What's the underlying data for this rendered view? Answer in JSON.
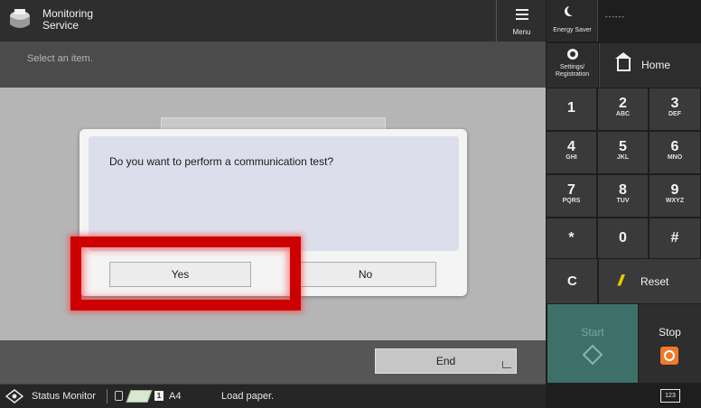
{
  "header": {
    "app_title": "Monitoring\nService",
    "menu_label": "Menu"
  },
  "subbar": {
    "instruction": "Select an item."
  },
  "dialog": {
    "message": "Do you want to perform a communication test?",
    "yes_label": "Yes",
    "no_label": "No"
  },
  "footer": {
    "end_label": "End"
  },
  "status_bar": {
    "status_monitor_label": "Status Monitor",
    "tray_number": "1",
    "paper_size": "A4",
    "message": "Load paper."
  },
  "right_panel": {
    "energy_saver_label": "Energy Saver",
    "indicator_text": "------",
    "settings_label": "Settings/\nRegistration",
    "home_label": "Home",
    "keys": [
      {
        "digit": "1",
        "letters": ""
      },
      {
        "digit": "2",
        "letters": "ABC"
      },
      {
        "digit": "3",
        "letters": "DEF"
      },
      {
        "digit": "4",
        "letters": "GHI"
      },
      {
        "digit": "5",
        "letters": "JKL"
      },
      {
        "digit": "6",
        "letters": "MNO"
      },
      {
        "digit": "7",
        "letters": "PQRS"
      },
      {
        "digit": "8",
        "letters": "TUV"
      },
      {
        "digit": "9",
        "letters": "WXYZ"
      },
      {
        "digit": "*",
        "letters": ""
      },
      {
        "digit": "0",
        "letters": ""
      },
      {
        "digit": "#",
        "letters": ""
      }
    ],
    "clear_label": "C",
    "reset_label": "Reset",
    "start_label": "Start",
    "stop_label": "Stop",
    "keyboard_label": "123"
  },
  "colors": {
    "highlight": "#cc0000",
    "start_button": "#3d7068",
    "stop_icon": "#f07a2a",
    "reset_icon": "#e8c700",
    "message_box": "#dcdfeb"
  }
}
